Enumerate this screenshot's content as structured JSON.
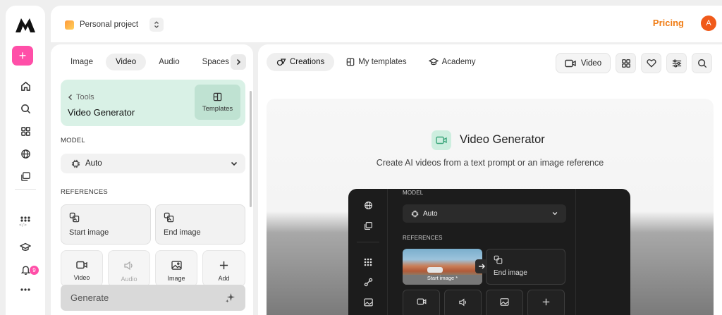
{
  "app": {
    "logo": "logo-mark",
    "new_label": "+"
  },
  "rail": {
    "badge_count": "9"
  },
  "topbar": {
    "project_name": "Personal project",
    "pricing_label": "Pricing",
    "avatar_initial": "A"
  },
  "left_panel": {
    "tabs": [
      {
        "label": "Image"
      },
      {
        "label": "Video"
      },
      {
        "label": "Audio"
      },
      {
        "label": "Spaces"
      }
    ],
    "active_tab": "Video",
    "tool": {
      "back_label": "Tools",
      "title": "Video Generator",
      "templates_label": "Templates"
    },
    "model": {
      "section_label": "MODEL",
      "value": "Auto"
    },
    "references": {
      "section_label": "REFERENCES",
      "start_image_label": "Start image",
      "end_image_label": "End image",
      "add_types": [
        {
          "label": "Video"
        },
        {
          "label": "Audio"
        },
        {
          "label": "Image"
        },
        {
          "label": "Add"
        }
      ]
    },
    "generate_label": "Generate"
  },
  "right_panel": {
    "tabs": [
      {
        "label": "Creations"
      },
      {
        "label": "My templates"
      },
      {
        "label": "Academy"
      }
    ],
    "active_tab": "Creations",
    "video_filter_label": "Video",
    "hero": {
      "title": "Video Generator",
      "subtitle": "Create AI videos from a text prompt or an image reference"
    },
    "preview": {
      "model_label": "MODEL",
      "model_value": "Auto",
      "references_label": "REFERENCES",
      "start_image_label": "Start image *",
      "end_image_label": "End image"
    }
  },
  "colors": {
    "accent_pink": "#ff4fa8",
    "pricing_orange": "#f07d16",
    "avatar": "#f05a1a",
    "tool_card": "#d9f1e6"
  }
}
